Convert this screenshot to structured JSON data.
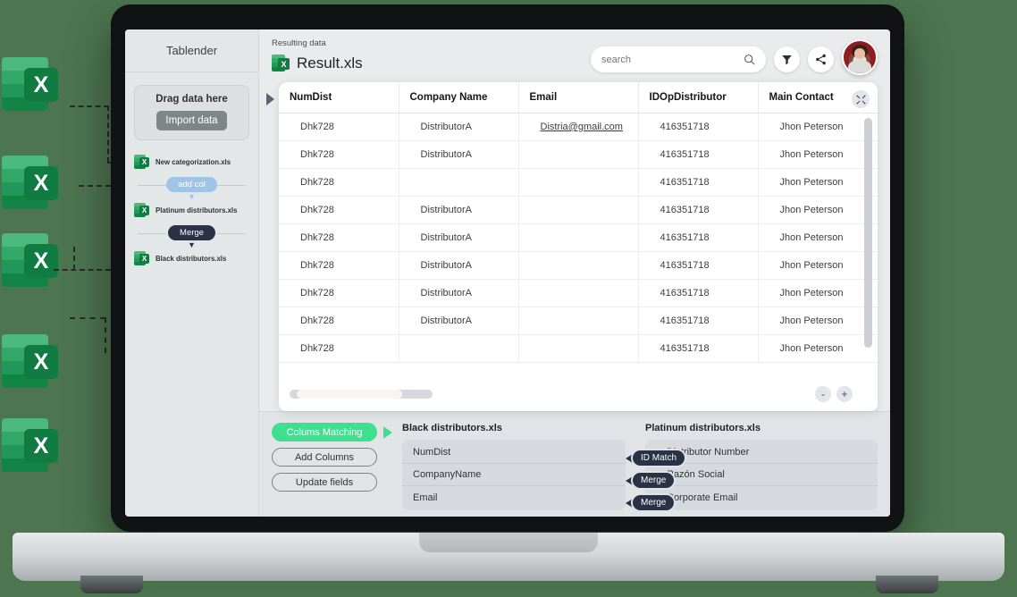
{
  "brand": {
    "name": "Tablender"
  },
  "sidebar": {
    "drop": {
      "title": "Drag data here",
      "button": "Import data"
    },
    "flow": [
      {
        "type": "file",
        "name": "New categorization.xls"
      },
      {
        "type": "pill",
        "label": "add col",
        "style": "addcol"
      },
      {
        "type": "file",
        "name": "Platinum distributors.xls"
      },
      {
        "type": "pill",
        "label": "Merge",
        "style": "merge"
      },
      {
        "type": "file",
        "name": "Black distributors.xls"
      }
    ]
  },
  "header": {
    "eyebrow": "Resulting data",
    "file_name": "Result.xls",
    "excel_letter": "X"
  },
  "search": {
    "value": "",
    "placeholder": "search"
  },
  "table": {
    "columns": [
      "NumDist",
      "Company Name",
      "Email",
      "IDOpDistributor",
      "Main Contact"
    ],
    "rows": [
      [
        "Dhk728",
        "DistributorA",
        "Distria@gmail.com",
        "416351718",
        "Jhon Peterson"
      ],
      [
        "Dhk728",
        "DistributorA",
        "",
        "416351718",
        "Jhon Peterson"
      ],
      [
        "Dhk728",
        "",
        "",
        "416351718",
        "Jhon Peterson"
      ],
      [
        "Dhk728",
        "DistributorA",
        "",
        "416351718",
        "Jhon Peterson"
      ],
      [
        "Dhk728",
        "DistributorA",
        "",
        "416351718",
        "Jhon Peterson"
      ],
      [
        "Dhk728",
        "DistributorA",
        "",
        "416351718",
        "Jhon Peterson"
      ],
      [
        "Dhk728",
        "DistributorA",
        "",
        "416351718",
        "Jhon Peterson"
      ],
      [
        "Dhk728",
        "DistributorA",
        "",
        "416351718",
        "Jhon Peterson"
      ],
      [
        "Dhk728",
        "",
        "",
        "416351718",
        "Jhon Peterson"
      ]
    ],
    "zoom_out": "-",
    "zoom_in": "+"
  },
  "bottom": {
    "buttons": [
      {
        "label": "Colums Matching",
        "active": true
      },
      {
        "label": "Add Columns",
        "active": false
      },
      {
        "label": "Update fields",
        "active": false
      }
    ],
    "left_panel": {
      "title": "Black distributors.xls",
      "fields": [
        "NumDist",
        "CompanyName",
        "Email"
      ]
    },
    "right_panel": {
      "title": "Platinum distributors.xls",
      "fields": [
        "Distributor Number",
        "Razón Social",
        "Corporate Email"
      ]
    },
    "connectors": [
      "ID Match",
      "Merge",
      "Merge"
    ]
  },
  "external_files": [
    {
      "letter": "X"
    },
    {
      "letter": "X"
    },
    {
      "letter": "X"
    },
    {
      "letter": "X"
    },
    {
      "letter": "X"
    }
  ],
  "colors": {
    "background": "#4d7650",
    "accent_green": "#3ee08f",
    "excel_green": "#107c41",
    "navy": "#2b3146",
    "addcol_blue": "#9ec5e8"
  }
}
